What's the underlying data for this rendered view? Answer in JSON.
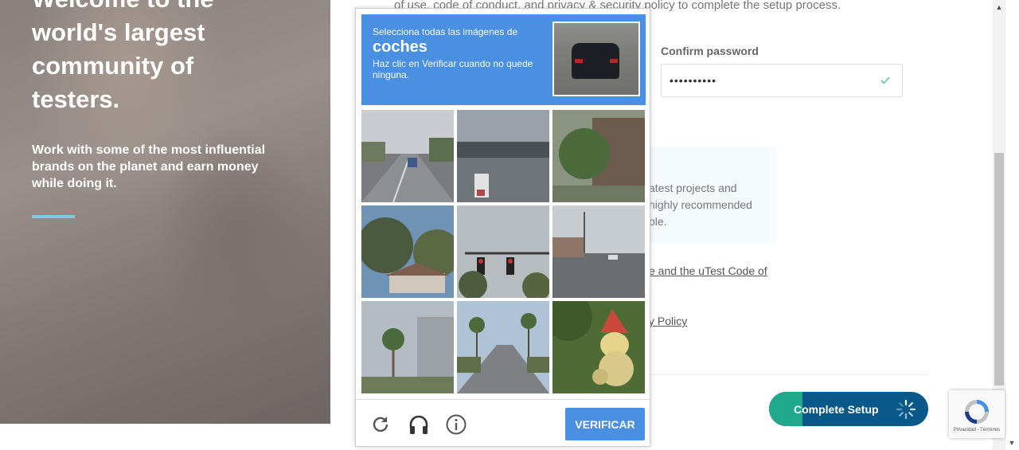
{
  "hero": {
    "title_lines": [
      "Welcome to the",
      "world's largest",
      "community of",
      "testers."
    ],
    "subtitle": "Work with some of the most influential brands on the planet and earn money while doing it."
  },
  "form": {
    "terms_line": "of use, code of conduct, and privacy & security policy to complete the setup process.",
    "confirm_password_label": "Confirm password",
    "confirm_password_value": "••••••••••",
    "info_text": "atest projects and highly recommended ble.",
    "agree_prefix": "e and the ",
    "agree_link": "uTest Code of",
    "policy_link": "y Policy",
    "complete_button": "Complete Setup"
  },
  "captcha": {
    "select_text": "Selecciona todas las imágenes de",
    "target_word": "coches",
    "instruction": "Haz clic en Verificar cuando no quede ninguna.",
    "verify_button": "VERIFICAR",
    "reload_icon": "reload-icon",
    "audio_icon": "headphones-icon",
    "info_icon": "info-icon",
    "tiles": [
      {
        "name": "highway"
      },
      {
        "name": "overpass"
      },
      {
        "name": "tree-building"
      },
      {
        "name": "trees-house"
      },
      {
        "name": "traffic-lights"
      },
      {
        "name": "intersection"
      },
      {
        "name": "palm-building"
      },
      {
        "name": "palm-street"
      },
      {
        "name": "garden-gnome"
      }
    ]
  },
  "recaptcha_badge": {
    "small_text": "Privacidad - Términos"
  },
  "colors": {
    "captcha_blue": "#4a90e2",
    "setup_teal": "#1fa88c",
    "setup_navy": "#08598a",
    "hero_accent": "#7ec8e3"
  }
}
